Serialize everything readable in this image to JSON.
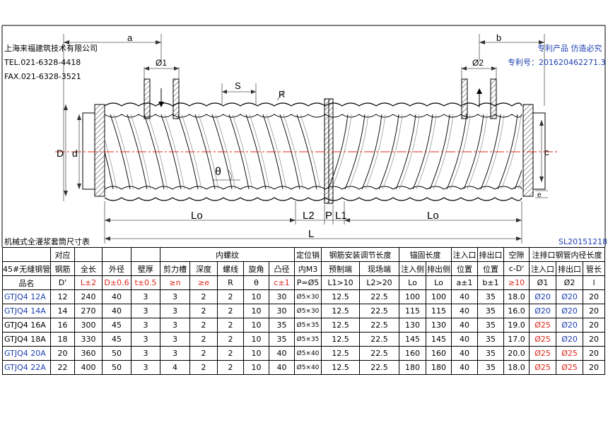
{
  "company": {
    "name": "上海来福建筑技术有限公司",
    "tel": "TEL.021-6328-4418",
    "fax": "FAX.021-6328-3521"
  },
  "patent": {
    "line1": "专利产品 仿造必究",
    "line2": "专利号：201620462271.3"
  },
  "drawing_labels": {
    "a": "a",
    "b": "b",
    "d1": "Ø1",
    "d2": "Ø2",
    "S": "S",
    "R": "R",
    "D": "D",
    "d": "d",
    "theta": "θ",
    "c": "c",
    "e": "e",
    "Lo_left": "Lo",
    "L2": "L2",
    "P": "P",
    "L1": "L1",
    "Lo_right": "Lo",
    "L": "L"
  },
  "table": {
    "title": "机械式全灌浆套筒尺寸表",
    "code": "SL20151218",
    "header1": {
      "duiying": "对应",
      "neiluowen": "内螺纹",
      "dingweixiao": "定位销",
      "tiaojie": "钢筋安装调节长度",
      "maogu": "锚固长度",
      "zhujiangkou": "注入口",
      "paichukou": "排出口",
      "kongxi": "空隙",
      "guanneijing": "注排口钢管内径长度"
    },
    "header2": {
      "material": "45#无缝钢管",
      "gangjin": "钢筋",
      "quanchang": "全长",
      "waijing": "外径",
      "bihou": "壁厚",
      "jianlicao": "剪力槽",
      "shendu": "深度",
      "luoxian": "螺线",
      "xuanjiao": "旋角",
      "tujing": "凸径",
      "neiM3": "内M3",
      "yuzhi": "预制端",
      "xianchang": "现场端",
      "zhurucE": "注入侧",
      "paichucE": "排出侧",
      "weizhi1": "位置",
      "weizhi2": "位置",
      "cdiff": "c-D'",
      "zhurukou2": "注入口",
      "paichukou2": "排出口",
      "guanchang": "管长"
    },
    "header3": {
      "pinming": "品名",
      "dprime": "D'",
      "L": "L±2",
      "D": "D±0.6",
      "t": "t±0.5",
      "n": "≥n",
      "e": "≥e",
      "R": "R",
      "theta": "θ",
      "c": "c±1",
      "P": "P=Ø5",
      "L1": "L1>10",
      "L2": "L2>20",
      "Lo1": "Lo",
      "Lo2": "Lo",
      "a": "a±1",
      "b": "b±1",
      "gap": "≥10",
      "d1": "Ø1",
      "d2": "Ø2",
      "l": "l"
    },
    "rows": [
      {
        "name": "GTJQ4 12A",
        "dp": "12",
        "L": "240",
        "D": "40",
        "t": "3",
        "n": "3",
        "e": "2",
        "R": "2",
        "theta": "10",
        "c": "30",
        "P": "Ø5×30",
        "L1": "12.5",
        "L2": "22.5",
        "Lo1": "100",
        "Lo2": "100",
        "a": "40",
        "b": "35",
        "gap": "18.0",
        "d1": "Ø20",
        "d2": "Ø20",
        "l": "20"
      },
      {
        "name": "GTJQ4 14A",
        "dp": "14",
        "L": "270",
        "D": "40",
        "t": "3",
        "n": "3",
        "e": "2",
        "R": "2",
        "theta": "10",
        "c": "30",
        "P": "Ø5×30",
        "L1": "12.5",
        "L2": "22.5",
        "Lo1": "115",
        "Lo2": "115",
        "a": "40",
        "b": "35",
        "gap": "16.0",
        "d1": "Ø20",
        "d2": "Ø20",
        "l": "20"
      },
      {
        "name": "GTJQ4 16A",
        "dp": "16",
        "L": "300",
        "D": "45",
        "t": "3",
        "n": "3",
        "e": "2",
        "R": "2",
        "theta": "10",
        "c": "35",
        "P": "Ø5×35",
        "L1": "12.5",
        "L2": "22.5",
        "Lo1": "130",
        "Lo2": "130",
        "a": "40",
        "b": "35",
        "gap": "19.0",
        "d1": "Ø25",
        "d2": "Ø20",
        "l": "20"
      },
      {
        "name": "GTJQ4 18A",
        "dp": "18",
        "L": "330",
        "D": "45",
        "t": "3",
        "n": "3",
        "e": "2",
        "R": "2",
        "theta": "10",
        "c": "35",
        "P": "Ø5×35",
        "L1": "12.5",
        "L2": "22.5",
        "Lo1": "145",
        "Lo2": "145",
        "a": "40",
        "b": "35",
        "gap": "17.0",
        "d1": "Ø25",
        "d2": "Ø20",
        "l": "20"
      },
      {
        "name": "GTJQ4 20A",
        "dp": "20",
        "L": "360",
        "D": "50",
        "t": "3",
        "n": "3",
        "e": "2",
        "R": "2",
        "theta": "10",
        "c": "40",
        "P": "Ø5×40",
        "L1": "12.5",
        "L2": "22.5",
        "Lo1": "160",
        "Lo2": "160",
        "a": "40",
        "b": "35",
        "gap": "20.0",
        "d1": "Ø25",
        "d2": "Ø25",
        "l": "20"
      },
      {
        "name": "GTJQ4 22A",
        "dp": "22",
        "L": "400",
        "D": "50",
        "t": "3",
        "n": "4",
        "e": "2",
        "R": "2",
        "theta": "10",
        "c": "40",
        "P": "Ø5×40",
        "L1": "12.5",
        "L2": "22.5",
        "Lo1": "180",
        "Lo2": "180",
        "a": "40",
        "b": "35",
        "gap": "18.0",
        "d1": "Ø25",
        "d2": "Ø25",
        "l": "20"
      }
    ]
  },
  "colors": {
    "text_blue": "#1d3fb0",
    "text_red": "#e0271a",
    "center_line": "#e0271a",
    "blue_names": [
      "GTJQ4 12A",
      "GTJQ4 14A",
      "GTJQ4 20A",
      "GTJQ4 22A"
    ]
  }
}
